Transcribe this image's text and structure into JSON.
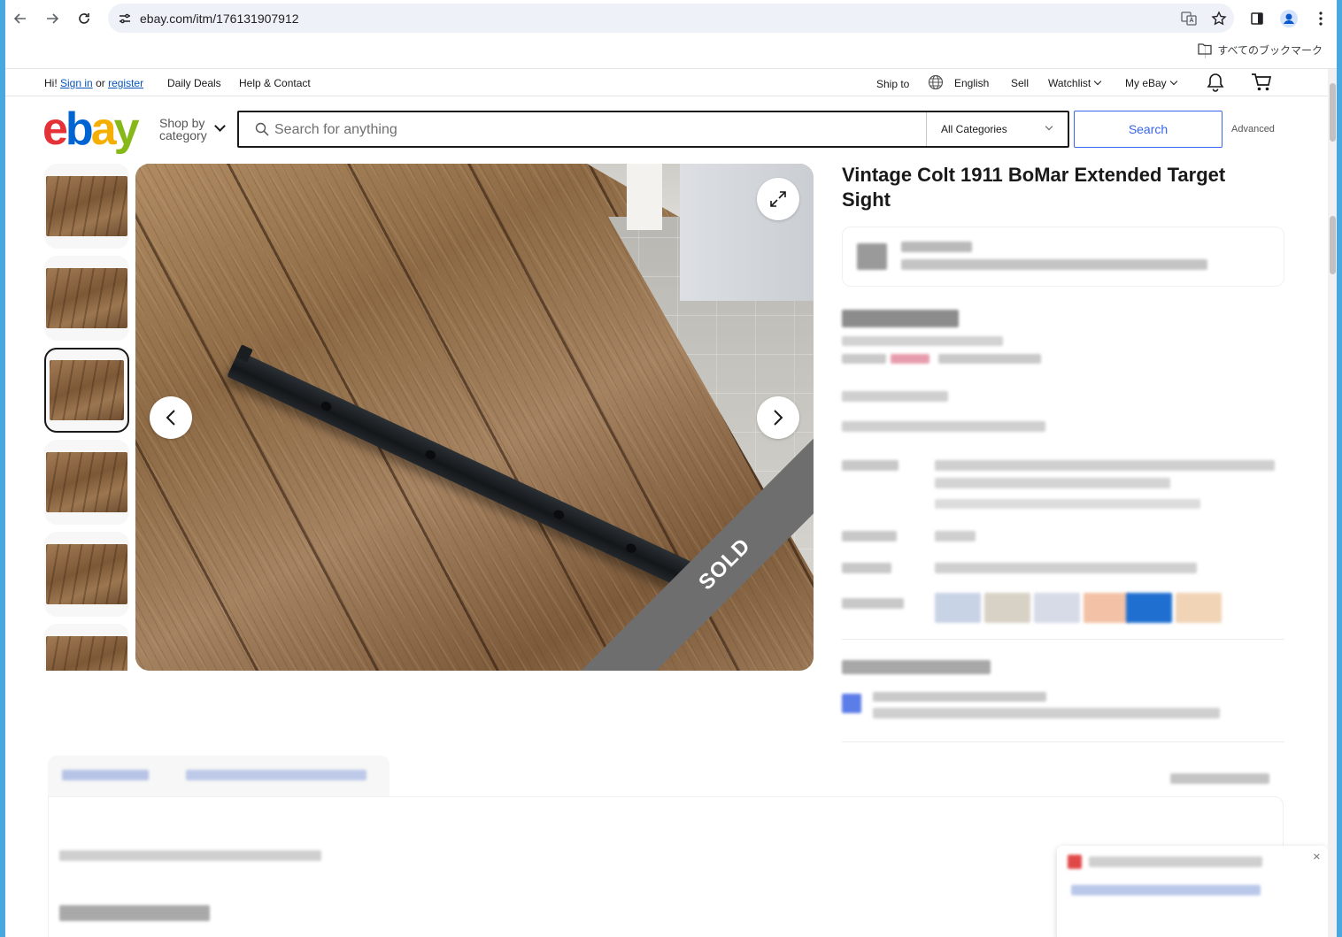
{
  "browser": {
    "url": "ebay.com/itm/176131907912",
    "bookmarks_label": "すべてのブックマーク"
  },
  "topnav": {
    "greeting": "Hi!",
    "sign_in": "Sign in",
    "or": "or",
    "register": "register",
    "daily_deals": "Daily Deals",
    "help_contact": "Help & Contact",
    "ship_to": "Ship to",
    "language": "English",
    "sell": "Sell",
    "watchlist": "Watchlist",
    "my_ebay": "My eBay"
  },
  "header": {
    "logo": {
      "e": "e",
      "b": "b",
      "a": "a",
      "y": "y"
    },
    "shop_by_line1": "Shop by",
    "shop_by_line2": "category",
    "search_placeholder": "Search for anything",
    "category_selected": "All Categories",
    "search_button": "Search",
    "advanced": "Advanced"
  },
  "listing": {
    "title": "Vintage Colt 1911 BoMar Extended Target Sight",
    "sold_label": "SOLD",
    "thumbnail_count": 6,
    "selected_thumbnail": 3
  },
  "colors": {
    "ebay_red": "#e53238",
    "ebay_blue": "#0064d2",
    "ebay_yellow": "#f5af02",
    "ebay_green": "#86b817",
    "link_blue": "#0654ba",
    "accent_blue": "#3665f3",
    "sold_band": "#6e6e6e"
  },
  "icons": [
    "back-icon",
    "forward-icon",
    "reload-icon",
    "site-settings-icon",
    "translate-icon",
    "star-icon",
    "side-panel-icon",
    "profile-icon",
    "kebab-menu-icon",
    "folder-icon",
    "globe-icon",
    "bell-icon",
    "cart-icon",
    "search-icon",
    "expand-icon",
    "chevron-left-icon",
    "chevron-right-icon"
  ]
}
